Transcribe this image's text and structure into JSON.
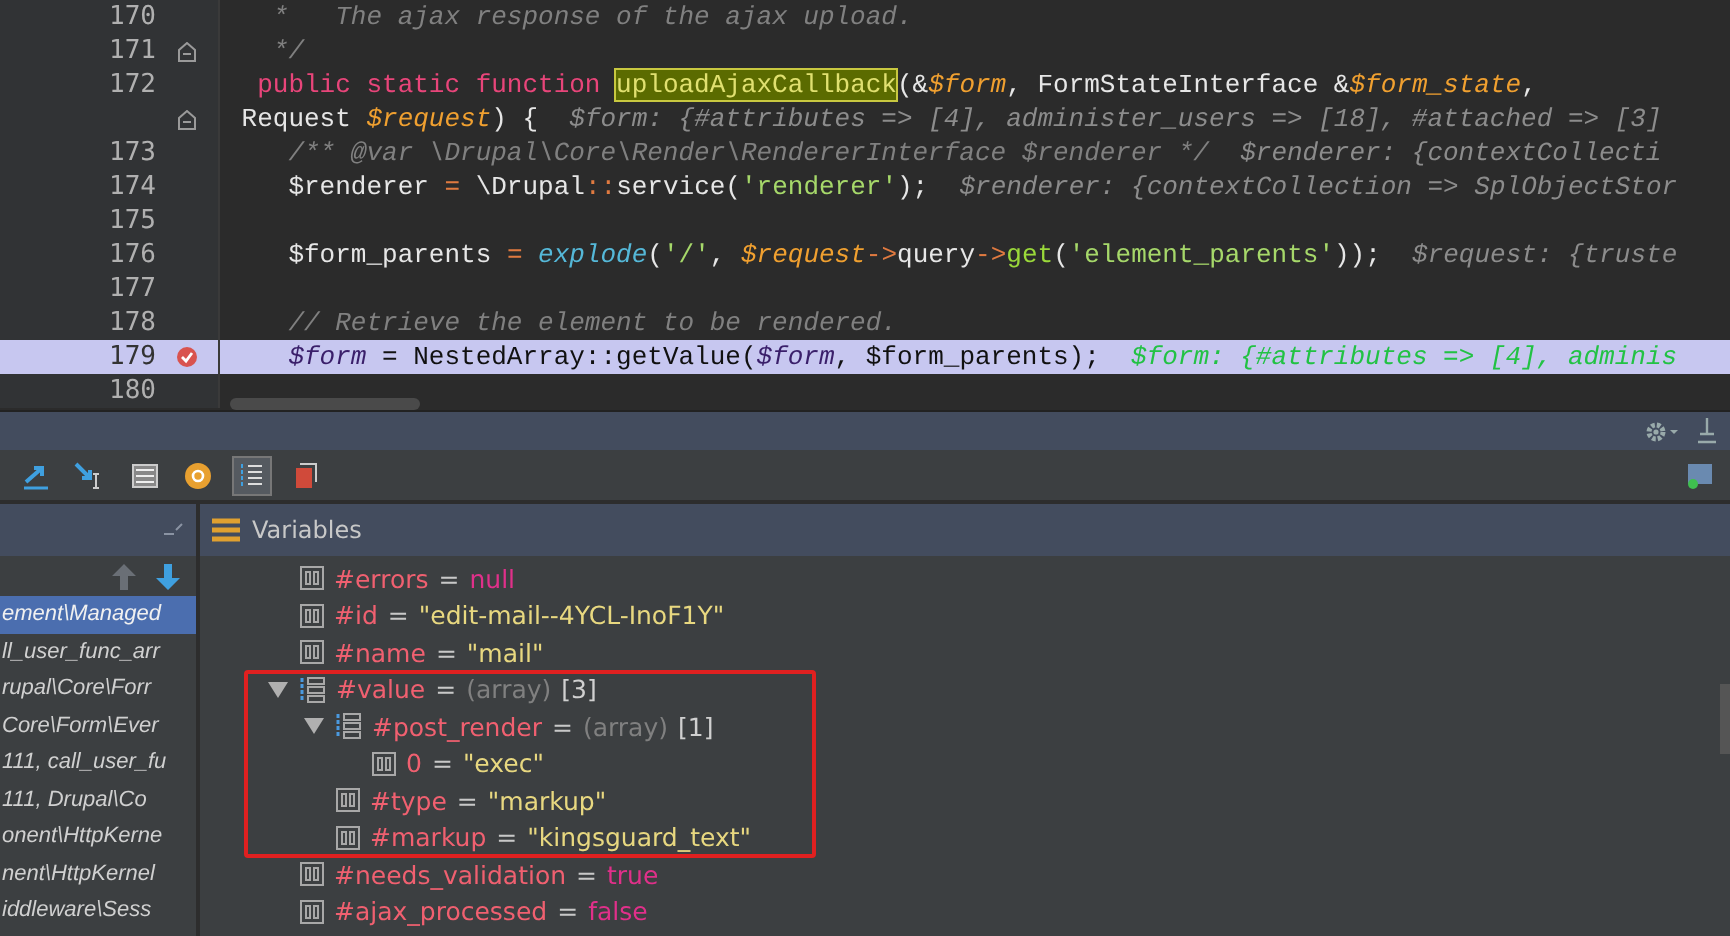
{
  "editor": {
    "lines": [
      {
        "number": "170",
        "fold": false,
        "breakpoint": false,
        "current": false,
        "segments": [
          {
            "kind": "comment",
            "text": "   *   The ajax response of the ajax upload."
          }
        ]
      },
      {
        "number": "171",
        "fold": true,
        "breakpoint": false,
        "current": false,
        "segments": [
          {
            "kind": "comment",
            "text": "   */"
          }
        ]
      },
      {
        "number": "172",
        "fold": false,
        "breakpoint": false,
        "current": false,
        "segments": [
          {
            "kind": "keyword",
            "text": "  public static function "
          },
          {
            "kind": "match",
            "text": "uploadAjaxCallback"
          },
          {
            "kind": "plain",
            "text": "(&"
          },
          {
            "kind": "param",
            "text": "$form"
          },
          {
            "kind": "plain",
            "text": ", FormStateInterface &"
          },
          {
            "kind": "param",
            "text": "$form_state"
          },
          {
            "kind": "plain",
            "text": ","
          }
        ]
      },
      {
        "fold": true,
        "breakpoint": false,
        "current": false,
        "segments": [
          {
            "kind": "plain",
            "text": " Request "
          },
          {
            "kind": "param",
            "text": "$request"
          },
          {
            "kind": "plain",
            "text": ") {  "
          },
          {
            "kind": "hint",
            "text": "$form: {#attributes => [4], administer_users => [18], #attached => [3]"
          }
        ]
      },
      {
        "number": "173",
        "fold": false,
        "breakpoint": false,
        "current": false,
        "segments": [
          {
            "kind": "comment",
            "text": "    /** @var \\Drupal\\Core\\Render\\RendererInterface $renderer */"
          },
          {
            "kind": "hint",
            "text": "  $renderer: {contextCollecti"
          }
        ]
      },
      {
        "number": "174",
        "fold": false,
        "breakpoint": false,
        "current": false,
        "segments": [
          {
            "kind": "plain",
            "text": "    $renderer "
          },
          {
            "kind": "op",
            "text": "="
          },
          {
            "kind": "plain",
            "text": " \\Drupal"
          },
          {
            "kind": "op",
            "text": "::"
          },
          {
            "kind": "plain",
            "text": "service("
          },
          {
            "kind": "string",
            "text": "'renderer'"
          },
          {
            "kind": "plain",
            "text": ");  "
          },
          {
            "kind": "hint",
            "text": "$renderer: {contextCollection => SplObjectStor"
          }
        ]
      },
      {
        "number": "175",
        "fold": false,
        "breakpoint": false,
        "current": false
      },
      {
        "number": "176",
        "fold": false,
        "breakpoint": false,
        "current": false,
        "segments": [
          {
            "kind": "plain",
            "text": "    $form_parents "
          },
          {
            "kind": "op",
            "text": "="
          },
          {
            "kind": "builtin",
            "text": " explode"
          },
          {
            "kind": "plain",
            "text": "("
          },
          {
            "kind": "string",
            "text": "'/'"
          },
          {
            "kind": "plain",
            "text": ", "
          },
          {
            "kind": "param",
            "text": "$request"
          },
          {
            "kind": "op",
            "text": "->"
          },
          {
            "kind": "plain",
            "text": "query"
          },
          {
            "kind": "op",
            "text": "->"
          },
          {
            "kind": "call",
            "text": "get"
          },
          {
            "kind": "plain",
            "text": "("
          },
          {
            "kind": "string",
            "text": "'element_parents'"
          },
          {
            "kind": "plain",
            "text": "));  "
          },
          {
            "kind": "hint",
            "text": "$request: {truste"
          }
        ]
      },
      {
        "number": "177",
        "fold": false,
        "breakpoint": false,
        "current": false
      },
      {
        "number": "178",
        "fold": false,
        "breakpoint": false,
        "current": false,
        "segments": [
          {
            "kind": "comment",
            "text": "    // Retrieve the element to be rendered."
          }
        ]
      },
      {
        "number": "179",
        "fold": false,
        "breakpoint": true,
        "current": true,
        "segments": [
          {
            "kind": "param",
            "text": "    $form"
          },
          {
            "kind": "plain",
            "text": " = NestedArray::getValue("
          },
          {
            "kind": "param",
            "text": "$form"
          },
          {
            "kind": "plain",
            "text": ", $form_parents);  "
          },
          {
            "kind": "hint",
            "text": "$form: {#attributes => [4], adminis"
          }
        ]
      },
      {
        "number": "180",
        "fold": false,
        "breakpoint": false,
        "current": false
      }
    ]
  },
  "frames": [
    {
      "text": "ement\\Managed",
      "selected": true
    },
    {
      "text": "ll_user_func_arr",
      "selected": false
    },
    {
      "text": "rupal\\Core\\Forr",
      "selected": false
    },
    {
      "text": "Core\\Form\\Ever",
      "selected": false
    },
    {
      "text": "111, call_user_fu",
      "selected": false
    },
    {
      "text": "111, Drupal\\Co",
      "selected": false
    },
    {
      "text": "onent\\HttpKerne",
      "selected": false
    },
    {
      "text": "nent\\HttpKernel",
      "selected": false
    },
    {
      "text": "iddleware\\Sess",
      "selected": false
    }
  ],
  "variables_title": "Variables",
  "variables": [
    {
      "name": "#errors",
      "operator": "=",
      "value": "null",
      "kind": "keyword",
      "boxed": false
    },
    {
      "name": "#id",
      "operator": "=",
      "value": "\"edit-mail--4YCL-InoF1Y\"",
      "kind": "string",
      "boxed": false
    },
    {
      "name": "#name",
      "operator": "=",
      "value": "\"mail\"",
      "kind": "string",
      "boxed": false
    },
    {
      "name": "#value",
      "operator": "=",
      "type_label": "(array)",
      "count": "[3]",
      "kind": "array",
      "expanded": true,
      "boxed": true,
      "children": [
        {
          "name": "#post_render",
          "operator": "=",
          "type_label": "(array)",
          "count": "[1]",
          "kind": "array",
          "expanded": true,
          "children": [
            {
              "name": "0",
              "operator": "=",
              "value": "\"exec\"",
              "kind": "string"
            }
          ]
        },
        {
          "name": "#type",
          "operator": "=",
          "value": "\"markup\"",
          "kind": "string"
        },
        {
          "name": "#markup",
          "operator": "=",
          "value": "\"kingsguard_text\"",
          "kind": "string"
        }
      ]
    },
    {
      "name": "#needs_validation",
      "operator": "=",
      "value": "true",
      "kind": "keyword",
      "boxed": false
    },
    {
      "name": "#ajax_processed",
      "operator": "=",
      "value": "false",
      "kind": "keyword",
      "boxed": false
    }
  ]
}
